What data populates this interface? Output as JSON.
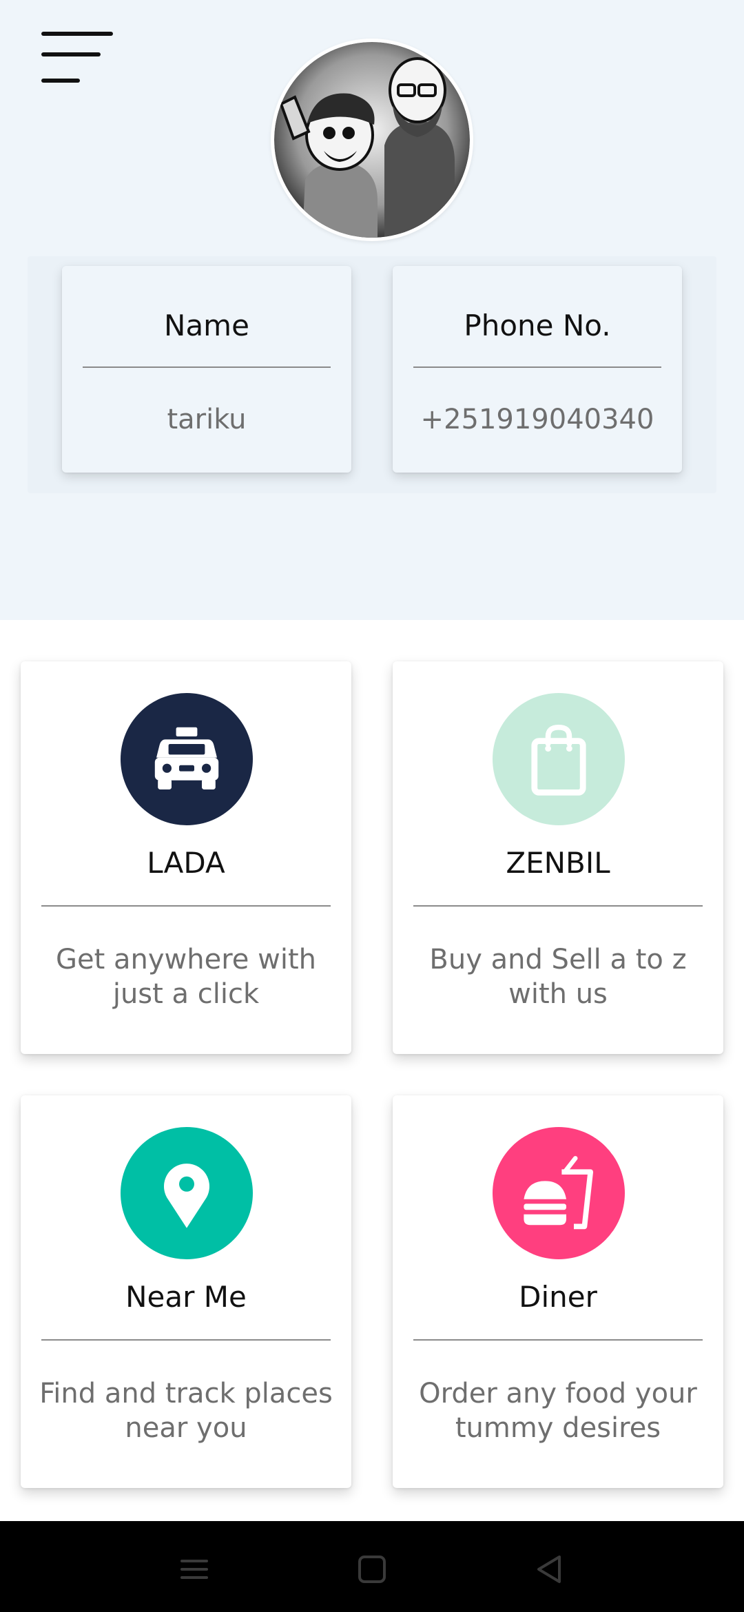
{
  "profile": {
    "name_label": "Name",
    "name_value": "tariku",
    "phone_label": "Phone No.",
    "phone_value": "+251919040340"
  },
  "services": [
    {
      "title": "LADA",
      "description": "Get anywhere with just a click",
      "icon": "taxi-icon",
      "color": "#1a2745"
    },
    {
      "title": "ZENBIL",
      "description": "Buy and Sell a to z with us",
      "icon": "shopping-bag-icon",
      "color": "#c6ebdb"
    },
    {
      "title": "Near Me",
      "description": "Find and track places near you",
      "icon": "location-pin-icon",
      "color": "#00bfa5"
    },
    {
      "title": "Diner",
      "description": "Order any food your tummy desires",
      "icon": "burger-drink-icon",
      "color": "#ff3f7f"
    }
  ],
  "colors": {
    "header_bg": "#eff5fa",
    "card_bg": "#ffffff",
    "navbar_bg": "#000000"
  }
}
